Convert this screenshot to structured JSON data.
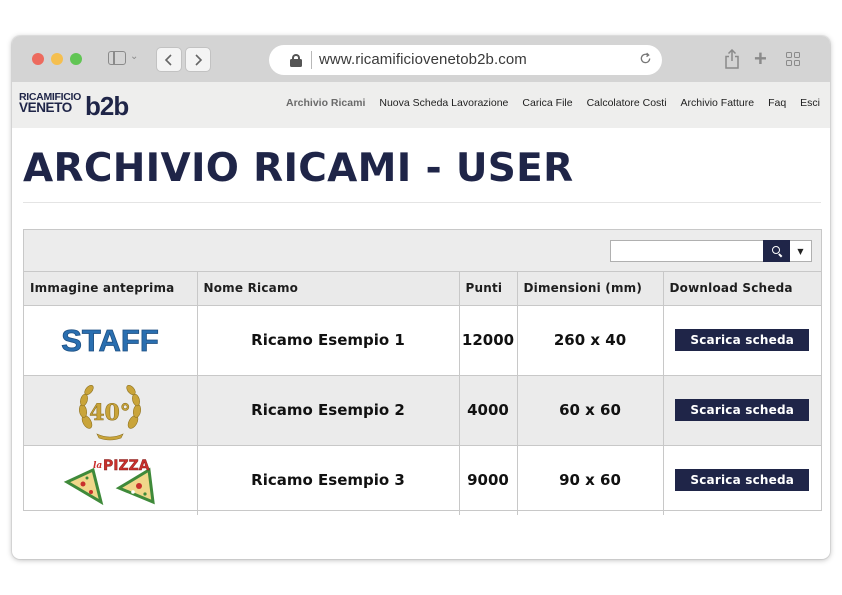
{
  "browser": {
    "url": "www.ricamificiovenetob2b.com"
  },
  "site": {
    "logo_top": "RICAMIFICIO",
    "logo_mid": "VENETO",
    "logo_b2b": "b2b",
    "menu": [
      {
        "label": "Archivio Ricami",
        "active": true
      },
      {
        "label": "Nuova Scheda Lavorazione"
      },
      {
        "label": "Carica File"
      },
      {
        "label": "Calcolatore Costi"
      },
      {
        "label": "Archivio Fatture"
      },
      {
        "label": "Faq"
      },
      {
        "label": "Esci"
      }
    ]
  },
  "page": {
    "title": "ARCHIVIO RICAMI - USER"
  },
  "search": {
    "value": ""
  },
  "table": {
    "headers": [
      "Immagine anteprima",
      "Nome Ricamo",
      "Punti",
      "Dimensioni (mm)",
      "Download Scheda"
    ],
    "rows": [
      {
        "image": "staff-embroidery-thumbnail",
        "image_text": "STAFF",
        "name": "Ricamo Esempio 1",
        "punti": "12000",
        "dimensioni": "260 x 40",
        "download_label": "Scarica scheda"
      },
      {
        "image": "laurel-40-thumbnail",
        "image_text": "40°",
        "name": "Ricamo Esempio 2",
        "punti": "4000",
        "dimensioni": "60 x 60",
        "download_label": "Scarica scheda"
      },
      {
        "image": "pizza-logo-thumbnail",
        "image_text": "PIZZA",
        "image_text_small": "la",
        "name": "Ricamo Esempio 3",
        "punti": "9000",
        "dimensioni": "90 x 60",
        "download_label": "Scarica scheda"
      }
    ]
  },
  "colors": {
    "brand_navy": "#1f2548",
    "header_bg": "#eeeeed",
    "toolbar_bg": "#ececec",
    "staff_blue": "#2a6fb0",
    "gold": "#c9a43a",
    "pizza_green": "#3f8a3a",
    "pizza_red": "#c9302c"
  }
}
